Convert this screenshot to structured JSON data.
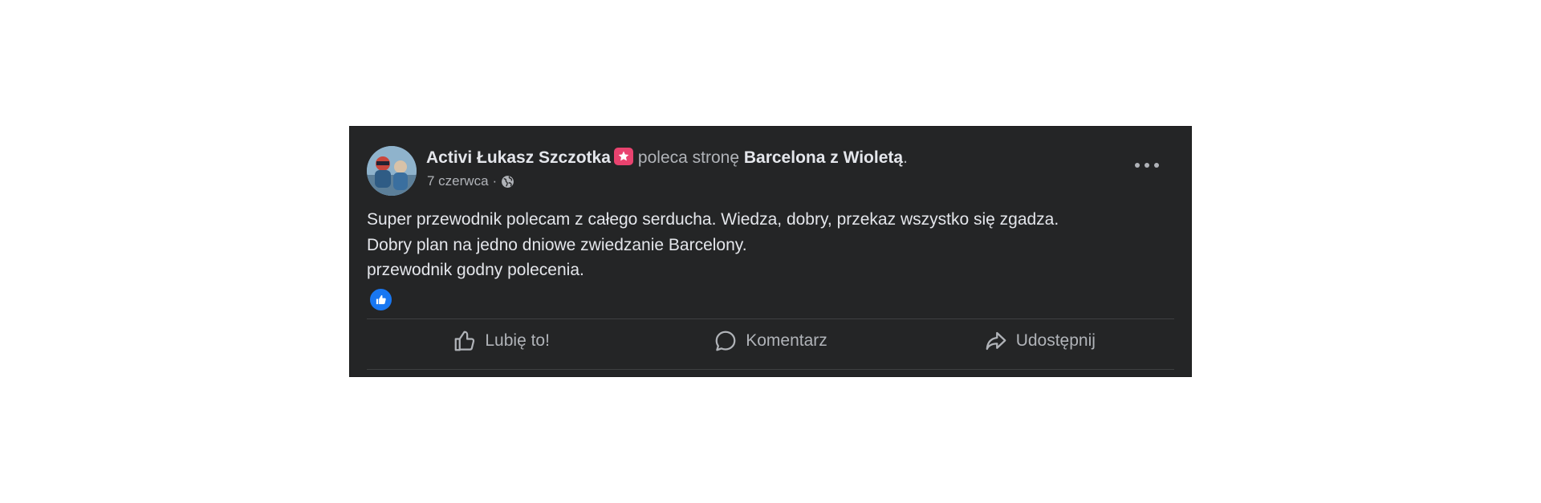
{
  "post": {
    "author": "Activi Łukasz Szczotka",
    "recommends_text": "poleca stronę",
    "page_name": "Barcelona z Wioletą",
    "page_suffix": ".",
    "date": "7 czerwca",
    "separator": "·",
    "privacy_icon": "globe-icon",
    "author_badge_icon": "star-badge-icon",
    "body_lines": [
      "Super przewodnik polecam z całego serducha. Wiedza, dobry, przekaz wszystko się zgadza.",
      "Dobry plan na jedno dniowe zwiedzanie Barcelony.",
      "przewodnik godny polecenia."
    ],
    "reaction_icon": "like-reaction-icon"
  },
  "actions": {
    "like_label": "Lubię to!",
    "comment_label": "Komentarz",
    "share_label": "Udostępnij"
  },
  "colors": {
    "card_background": "#242526",
    "primary_text": "#e4e6eb",
    "secondary_text": "#b0b3b8",
    "like_blue": "#1877f2",
    "badge_pink": "#e9436f"
  }
}
